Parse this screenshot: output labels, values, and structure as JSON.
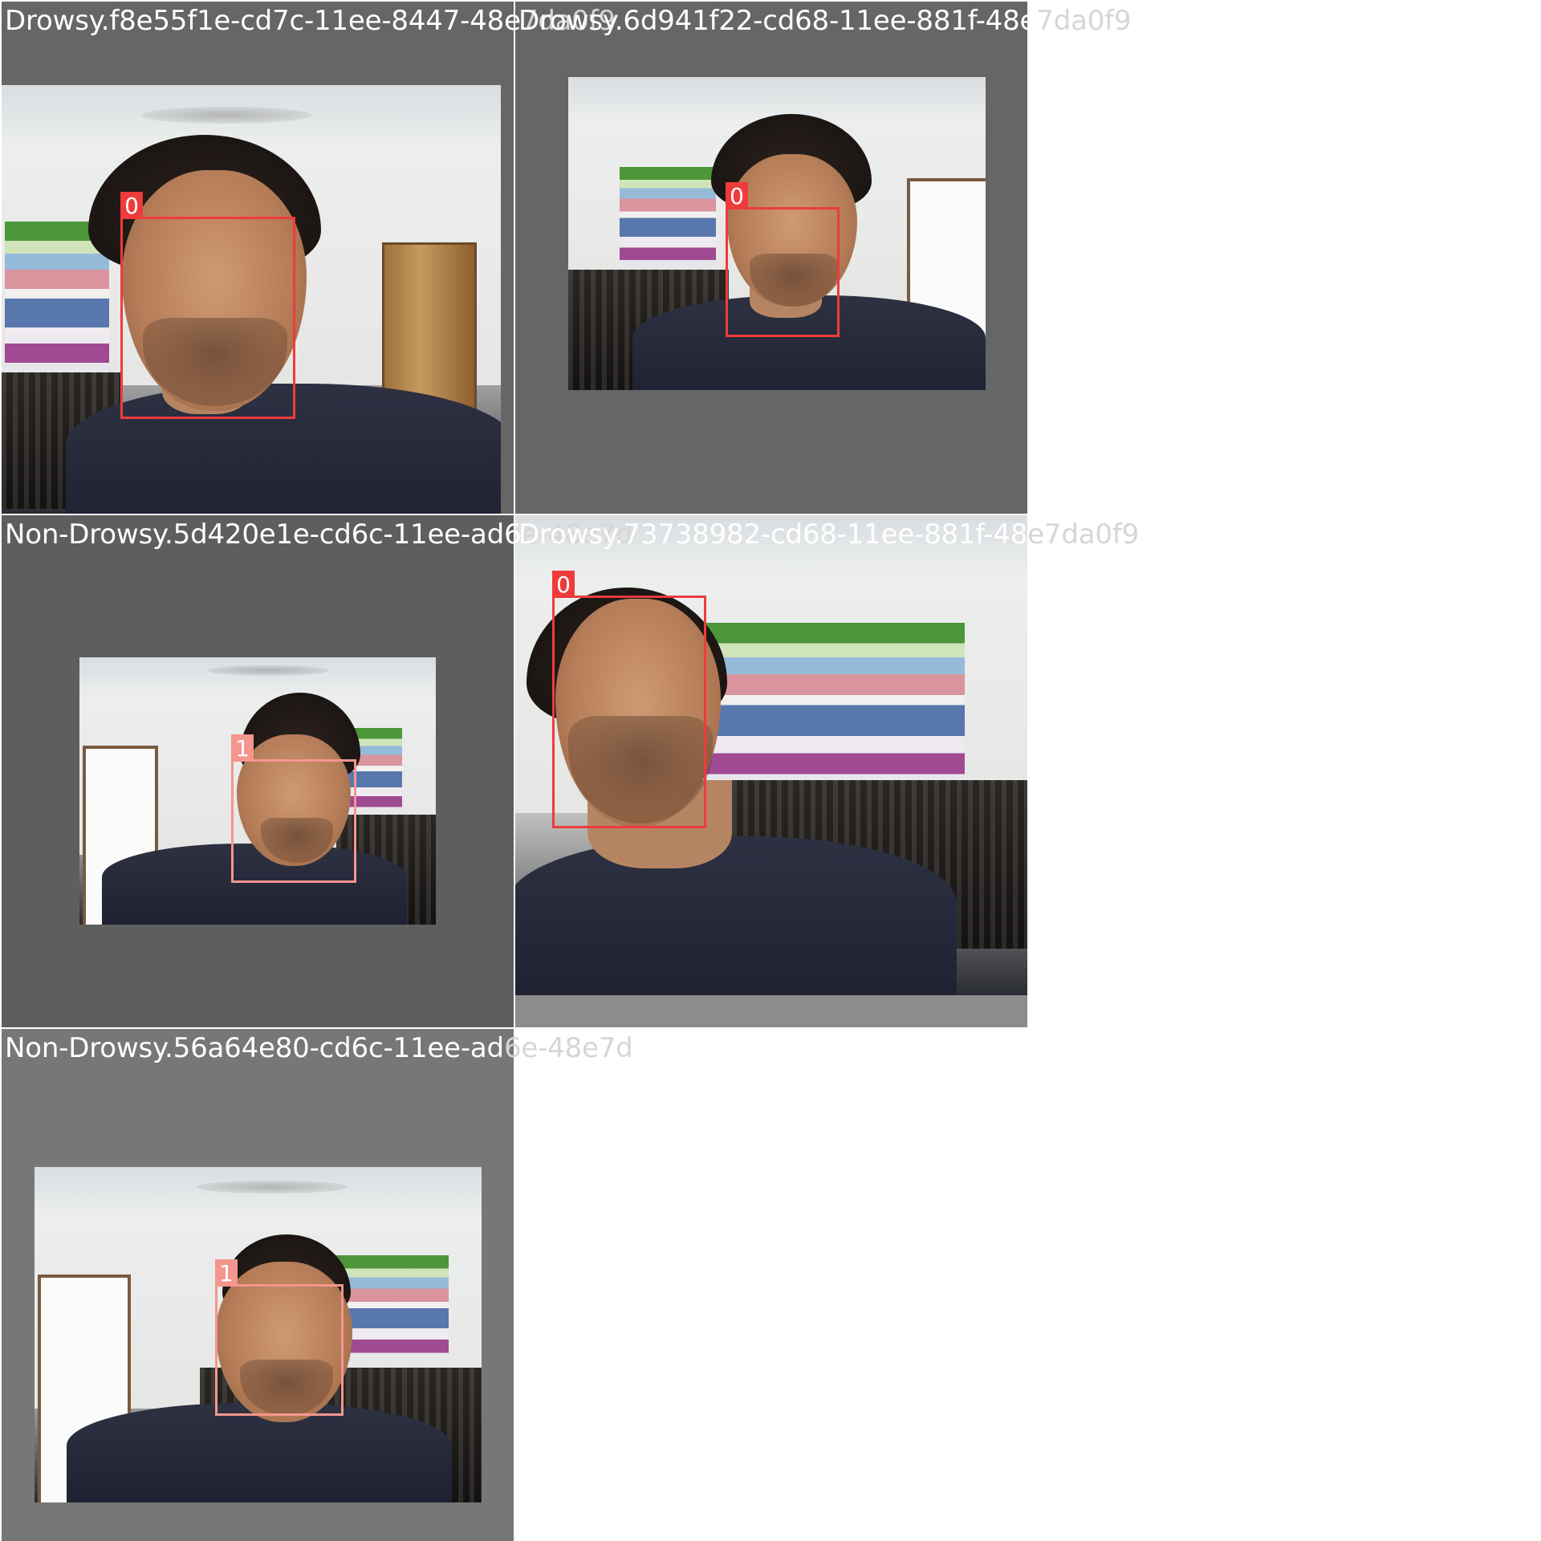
{
  "grid": {
    "tiles": [
      {
        "id": "tile-1",
        "caption_main": "Drowsy.f8e55f1e-cd7c-11ee-8447-48e",
        "caption_spill": "7da0f9",
        "class_label": "0",
        "box_color": "#ef3b3b",
        "background": "#666666"
      },
      {
        "id": "tile-2",
        "caption_main": "Drowsy.6d941f22-cd68-11ee-881f-48e",
        "caption_spill": "7da0f9",
        "class_label": "0",
        "box_color": "#ef3b3b",
        "background": "#666666"
      },
      {
        "id": "tile-3",
        "caption_main": "Non-Drowsy.5d420e1e-cd6c-11ee-ad6",
        "caption_spill": "e-48e7d",
        "class_label": "1",
        "box_color": "#f4968e",
        "background": "#5e5e5e"
      },
      {
        "id": "tile-4",
        "caption_main": "Drowsy.73738982-cd68-11ee-881f-48",
        "caption_spill": "e7da0f9",
        "class_label": "0",
        "box_color": "#ef3b3b",
        "background": "#8c8c8c"
      },
      {
        "id": "tile-5",
        "caption_main": "Non-Drowsy.56a64e80-cd6c-11ee-ad",
        "caption_spill": "6e-48e7d",
        "class_label": "1",
        "box_color": "#f4968e",
        "background": "#777777"
      }
    ]
  }
}
